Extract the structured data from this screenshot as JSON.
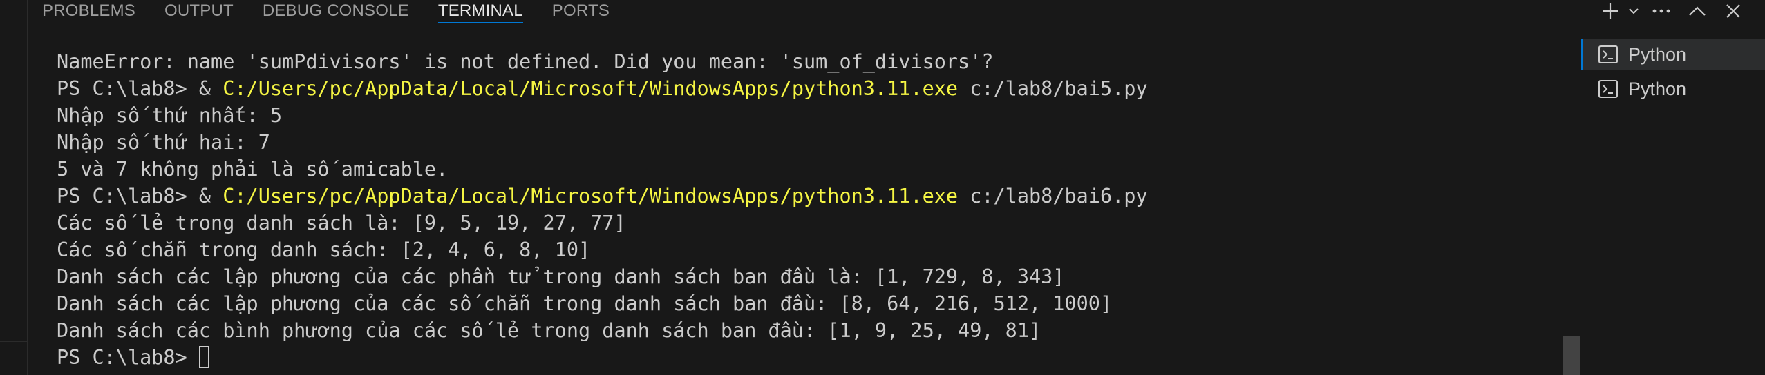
{
  "panel_tabs": [
    "PROBLEMS",
    "OUTPUT",
    "DEBUG CONSOLE",
    "TERMINAL",
    "PORTS"
  ],
  "active_tab": "TERMINAL",
  "actions": {
    "new_terminal": "plus-icon",
    "launch_profile": "chevron-down-icon",
    "more_actions": "ellipsis-icon",
    "maximize_panel": "chevron-up-icon",
    "close_panel": "close-icon"
  },
  "terminal_lines": [
    {
      "text": "NameError: name 'sumPdivisors' is not defined. Did you mean: 'sum_of_divisors'?"
    },
    {
      "prompt": "PS C:\\lab8> & ",
      "exe": "C:/Users/pc/AppData/Local/Microsoft/WindowsApps/python3.11.exe",
      "arg": " c:/lab8/bai5.py"
    },
    {
      "text": "Nhập số thứ nhất: 5"
    },
    {
      "text": "Nhập số thứ hai: 7"
    },
    {
      "text": "5 và 7 không phải là số amicable."
    },
    {
      "prompt": "PS C:\\lab8> & ",
      "exe": "C:/Users/pc/AppData/Local/Microsoft/WindowsApps/python3.11.exe",
      "arg": " c:/lab8/bai6.py"
    },
    {
      "text": "Các số lẻ trong danh sách là: [9, 5, 19, 27, 77]"
    },
    {
      "text": "Các số chẵn trong danh sách: [2, 4, 6, 8, 10]"
    },
    {
      "text": "Danh sách các lập phương của các phần tử trong danh sách ban đầu là: [1, 729, 8, 343]"
    },
    {
      "text": "Danh sách các lập phương của các số chẵn trong danh sách ban đầu: [8, 64, 216, 512, 1000]"
    },
    {
      "text": "Danh sách các bình phương của các số lẻ trong danh sách ban đầu: [1, 9, 25, 49, 81]"
    },
    {
      "prompt": "PS C:\\lab8> ",
      "cursor": true
    }
  ],
  "terminal_list": [
    "Python",
    "Python"
  ],
  "colors": {
    "background": "#181818",
    "text": "#cccccc",
    "path_highlight": "#f5f543",
    "accent": "#0078d4"
  }
}
